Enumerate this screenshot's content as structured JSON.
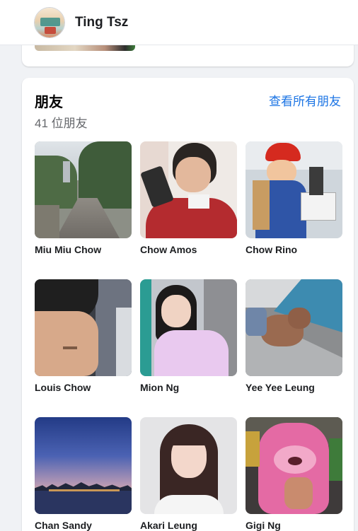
{
  "header": {
    "name": "Ting Tsz"
  },
  "friends_section": {
    "title": "朋友",
    "count_text": "41 位朋友",
    "see_all": "查看所有朋友",
    "friends": [
      {
        "name": "Miu Miu Chow"
      },
      {
        "name": "Chow Amos"
      },
      {
        "name": "Chow Rino"
      },
      {
        "name": "Louis Chow"
      },
      {
        "name": "Mion Ng"
      },
      {
        "name": "Yee Yee Leung"
      },
      {
        "name": "Chan Sandy"
      },
      {
        "name": "Akari Leung"
      },
      {
        "name": "Gigi Ng"
      }
    ]
  },
  "colors": {
    "link": "#1b74e4",
    "background": "#f0f2f5"
  }
}
